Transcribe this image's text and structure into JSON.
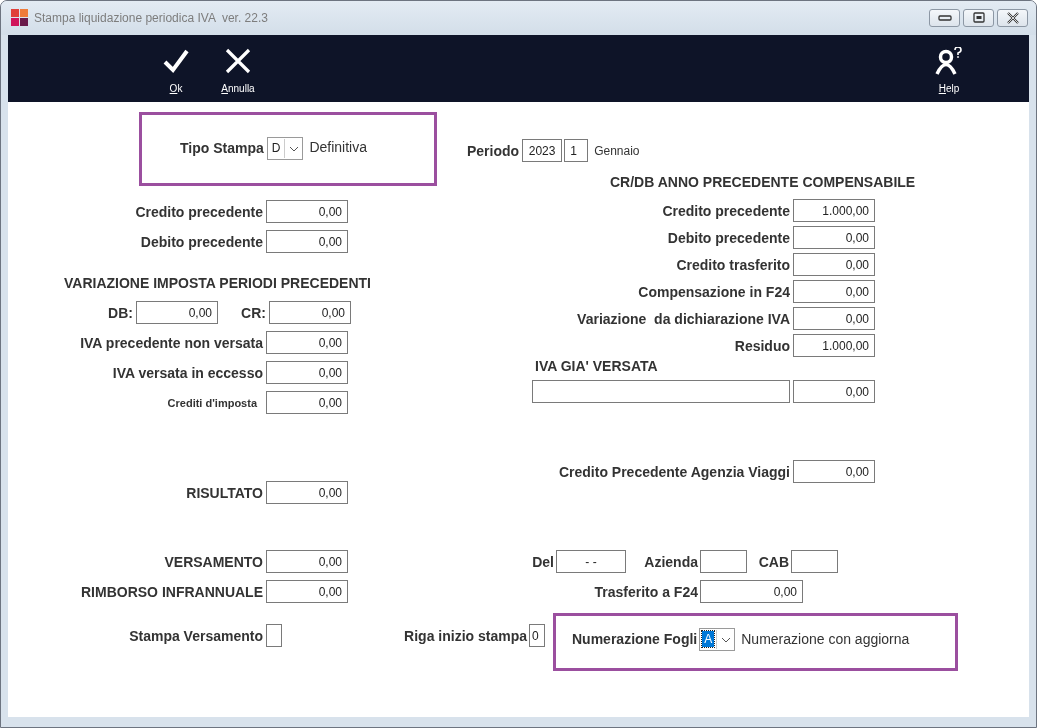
{
  "window": {
    "title": "Stampa liquidazione periodica IVA  ver. 22.3"
  },
  "toolbar": [
    {
      "kind": "ok",
      "label": "Ok"
    },
    {
      "kind": "cancel",
      "label": "Annulla"
    },
    {
      "kind": "help",
      "label": "Help"
    }
  ],
  "tipo_stampa": {
    "label": "Tipo Stampa",
    "value": "D",
    "description": "Definitiva"
  },
  "periodo": {
    "label": "Periodo",
    "year": "2023",
    "month": "1",
    "month_name": "Gennaio"
  },
  "left": [
    {
      "kind": "field",
      "label": "Credito precedente",
      "value": "0,00"
    },
    {
      "kind": "field",
      "label": "Debito precedente",
      "value": "0,00"
    },
    {
      "kind": "heading",
      "label": "VARIAZIONE IMPOSTA PERIODI PRECEDENTI"
    },
    {
      "kind": "pair",
      "label": "DB:",
      "value": "0,00",
      "label2": "CR:",
      "value2": "0,00"
    },
    {
      "kind": "field",
      "label": "IVA precedente non versata",
      "value": "0,00"
    },
    {
      "kind": "field",
      "label": "IVA versata in eccesso",
      "value": "0,00"
    },
    {
      "kind": "small",
      "label": "Crediti d'imposta",
      "value": "0,00"
    }
  ],
  "risultato": {
    "label": "RISULTATO",
    "value": "0,00"
  },
  "right_heading": "CR/DB ANNO PRECEDENTE COMPENSABILE",
  "right": [
    {
      "label": "Credito precedente",
      "value": "1.000,00"
    },
    {
      "label": "Debito precedente",
      "value": "0,00"
    },
    {
      "label": "Credito trasferito",
      "value": "0,00"
    },
    {
      "label": "Compensazione in F24",
      "value": "0,00"
    },
    {
      "label": "Variazione  da dichiarazione IVA",
      "value": "0,00"
    },
    {
      "label": "Residuo",
      "value": "1.000,00"
    }
  ],
  "iva_gia_versata": {
    "label": "IVA GIA' VERSATA",
    "value": "0,00"
  },
  "agenzia": {
    "label": "Credito Precedente Agenzia Viaggi",
    "value": "0,00"
  },
  "versamento": {
    "label": "VERSAMENTO",
    "value": "0,00"
  },
  "rimborso": {
    "label": "RIMBORSO INFRANNUALE",
    "value": "0,00"
  },
  "stampa_versamento": {
    "label": "Stampa Versamento",
    "checked": false
  },
  "del": {
    "label": "Del",
    "value": "- -"
  },
  "azienda": {
    "label": "Azienda"
  },
  "cab": {
    "label": "CAB"
  },
  "trasferito": {
    "label": "Trasferito a F24",
    "value": "0,00"
  },
  "riga": {
    "label": "Riga inizio stampa",
    "value": "0"
  },
  "numerazione": {
    "label": "Numerazione Fogli",
    "value": "A",
    "selected": true,
    "description": "Numerazione con aggiorna"
  }
}
